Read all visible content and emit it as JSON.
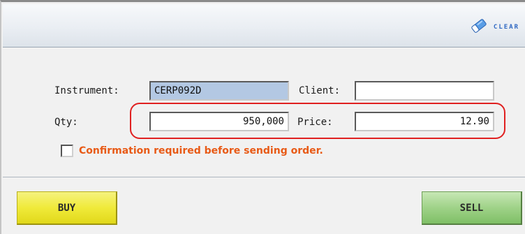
{
  "toolbar": {
    "clear_label": "CLEAR"
  },
  "form": {
    "instrument_label": "Instrument:",
    "instrument_value": "CERP092D",
    "client_label": "Client:",
    "client_value": "",
    "qty_label": "Qty:",
    "qty_value": "950,000",
    "price_label": "Price:",
    "price_value": "12.90",
    "confirm_label": "Confirmation required before sending order.",
    "confirm_checked": false
  },
  "actions": {
    "buy_label": "BUY",
    "sell_label": "SELL"
  },
  "icons": {
    "clear": "eraser-icon",
    "checkbox": "checkbox-icon"
  },
  "colors": {
    "confirm_text": "#e85a16",
    "highlight": "#e02020",
    "buy": "#f0ea3a",
    "sell": "#9fd288",
    "clear_text": "#2f68c2"
  }
}
